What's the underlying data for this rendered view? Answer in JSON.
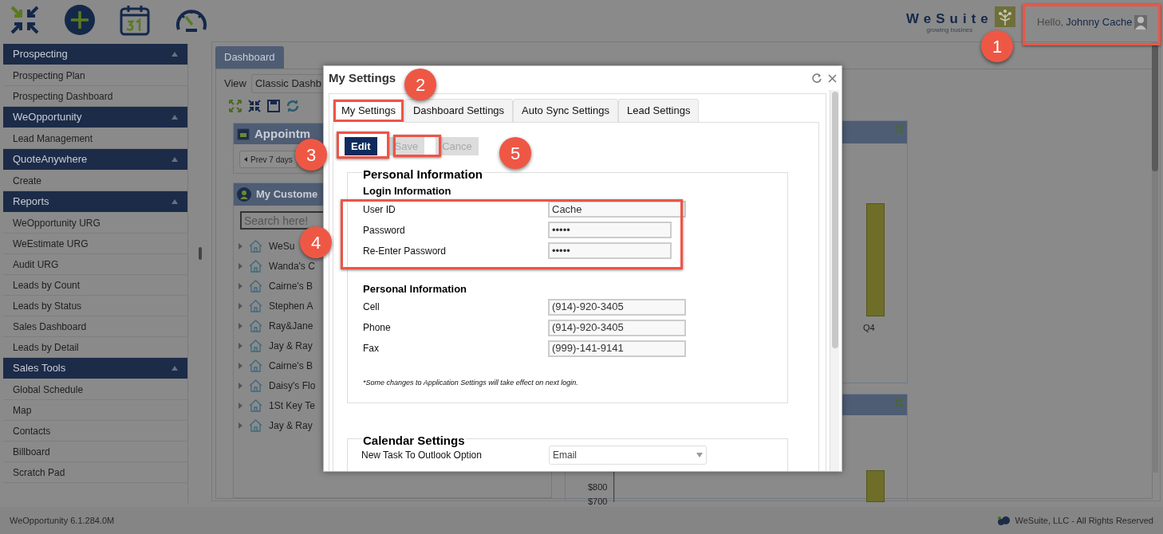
{
  "brand": {
    "name": "WeSuite",
    "tagline": "growing busines"
  },
  "user": {
    "greeting": "Hello,",
    "name": "Johnny Cache"
  },
  "sidebar": {
    "sections": [
      {
        "title": "Prospecting",
        "expanded": true,
        "items": [
          "Prospecting Plan",
          "Prospecting Dashboard"
        ]
      },
      {
        "title": "WeOpportunity",
        "expanded": true,
        "items": [
          "Lead Management"
        ]
      },
      {
        "title": "QuoteAnywhere",
        "expanded": true,
        "items": [
          "Create"
        ]
      },
      {
        "title": "Reports",
        "expanded": true,
        "items": [
          "WeOpportunity URG",
          "WeEstimate URG",
          "Audit URG",
          "Leads by Count",
          "Leads by Status",
          "Sales Dashboard",
          "Leads by Detail"
        ]
      },
      {
        "title": "Sales Tools",
        "expanded": true,
        "items": [
          "Global Schedule",
          "Map",
          "Contacts",
          "Billboard",
          "Scratch Pad"
        ]
      }
    ]
  },
  "main": {
    "tab": "Dashboard",
    "view_label": "View",
    "view_value": "Classic Dashb",
    "appointments": {
      "title": "Appointm",
      "prev_button": "Prev 7 days"
    },
    "customers": {
      "title": "My Custome",
      "search_placeholder": "Search here!",
      "items": [
        "WeSu",
        "Wanda's C",
        "Cairne's B",
        "Stephen A",
        "Ray&Jane",
        "Jay & Ray",
        "Cairne's B",
        "Daisy's Flo",
        "1St Key Te",
        "Jay & Ray"
      ]
    },
    "chart_labels": {
      "category": "Q4",
      "ticks": [
        "$800",
        "$700"
      ]
    }
  },
  "modal": {
    "title": "My Settings",
    "tabs": [
      {
        "label": "My Settings",
        "selected": true
      },
      {
        "label": "Dashboard Settings",
        "selected": false
      },
      {
        "label": "Auto Sync Settings",
        "selected": false
      },
      {
        "label": "Lead Settings",
        "selected": false
      }
    ],
    "buttons": [
      {
        "label": "Edit",
        "disabled": false
      },
      {
        "label": "Save",
        "disabled": true
      },
      {
        "label": "Cance",
        "disabled": true
      }
    ],
    "personal": {
      "legend": "Personal Information",
      "groups": [
        {
          "heading": "Login Information",
          "rows": [
            {
              "label": "User ID",
              "value": "Cache",
              "kind": "text"
            },
            {
              "label": "Password",
              "value": "•••••",
              "kind": "password"
            },
            {
              "label": "Re-Enter Password",
              "value": "•••••",
              "kind": "password"
            }
          ]
        },
        {
          "heading": "Personal Information",
          "rows": [
            {
              "label": "Cell",
              "value": "(914)-920-3405",
              "kind": "text"
            },
            {
              "label": "Phone",
              "value": "(914)-920-3405",
              "kind": "text"
            },
            {
              "label": "Fax",
              "value": "(999)-141-9141",
              "kind": "text"
            }
          ]
        }
      ],
      "note": "*Some changes to Application Settings will take effect on next login."
    },
    "calendar": {
      "legend": "Calendar Settings",
      "rows": [
        {
          "label": "New Task To Outlook Option",
          "value": "Email"
        }
      ]
    }
  },
  "footer": {
    "version": "WeOpportunity 6.1.284.0M",
    "copyright": "WeSuite, LLC - All Rights Reserved"
  },
  "callouts": [
    "1",
    "2",
    "3",
    "4",
    "5"
  ]
}
